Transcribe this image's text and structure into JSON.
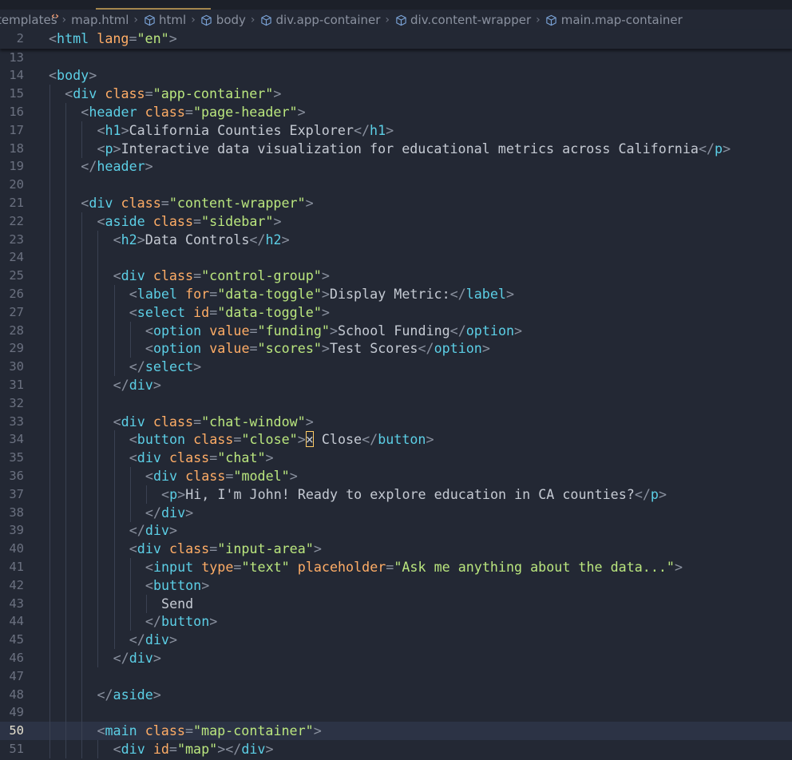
{
  "breadcrumb": [
    {
      "label": "templates",
      "icon": ""
    },
    {
      "label": "map.html",
      "icon": "html-file-icon"
    },
    {
      "label": "html",
      "icon": "element-cube-icon"
    },
    {
      "label": "body",
      "icon": "element-cube-icon"
    },
    {
      "label": "div.app-container",
      "icon": "element-cube-icon"
    },
    {
      "label": "div.content-wrapper",
      "icon": "element-cube-icon"
    },
    {
      "label": "main.map-container",
      "icon": "element-cube-icon"
    }
  ],
  "sticky": {
    "number": "2",
    "code": [
      {
        "t": "punct",
        "v": "<"
      },
      {
        "t": "tag",
        "v": "html"
      },
      {
        "t": "txt",
        "v": " "
      },
      {
        "t": "attr",
        "v": "lang"
      },
      {
        "t": "punct",
        "v": "="
      },
      {
        "t": "str",
        "v": "\"en\""
      },
      {
        "t": "punct",
        "v": ">"
      }
    ]
  },
  "current_line": "50",
  "colors": {
    "background": "#232834",
    "tag": "#5ccfe6",
    "attribute": "#ffad66",
    "string": "#bae67e",
    "text": "#c5cad3",
    "current_line": "#2c3345",
    "cursor": "#ffcc66"
  },
  "lines": [
    {
      "n": "13",
      "indent": 0,
      "code": []
    },
    {
      "n": "14",
      "indent": 0,
      "code": [
        {
          "t": "punct",
          "v": "<"
        },
        {
          "t": "tag",
          "v": "body"
        },
        {
          "t": "punct",
          "v": ">"
        }
      ]
    },
    {
      "n": "15",
      "indent": 1,
      "code": [
        {
          "t": "punct",
          "v": "<"
        },
        {
          "t": "tag",
          "v": "div"
        },
        {
          "t": "txt",
          "v": " "
        },
        {
          "t": "attr",
          "v": "class"
        },
        {
          "t": "punct",
          "v": "="
        },
        {
          "t": "str",
          "v": "\"app-container\""
        },
        {
          "t": "punct",
          "v": ">"
        }
      ]
    },
    {
      "n": "16",
      "indent": 2,
      "code": [
        {
          "t": "punct",
          "v": "<"
        },
        {
          "t": "tag",
          "v": "header"
        },
        {
          "t": "txt",
          "v": " "
        },
        {
          "t": "attr",
          "v": "class"
        },
        {
          "t": "punct",
          "v": "="
        },
        {
          "t": "str",
          "v": "\"page-header\""
        },
        {
          "t": "punct",
          "v": ">"
        }
      ]
    },
    {
      "n": "17",
      "indent": 3,
      "code": [
        {
          "t": "punct",
          "v": "<"
        },
        {
          "t": "tag",
          "v": "h1"
        },
        {
          "t": "punct",
          "v": ">"
        },
        {
          "t": "txt",
          "v": "California Counties Explorer"
        },
        {
          "t": "punct",
          "v": "</"
        },
        {
          "t": "tag",
          "v": "h1"
        },
        {
          "t": "punct",
          "v": ">"
        }
      ]
    },
    {
      "n": "18",
      "indent": 3,
      "code": [
        {
          "t": "punct",
          "v": "<"
        },
        {
          "t": "tag",
          "v": "p"
        },
        {
          "t": "punct",
          "v": ">"
        },
        {
          "t": "txt",
          "v": "Interactive data visualization for educational metrics across California"
        },
        {
          "t": "punct",
          "v": "</"
        },
        {
          "t": "tag",
          "v": "p"
        },
        {
          "t": "punct",
          "v": ">"
        }
      ]
    },
    {
      "n": "19",
      "indent": 2,
      "code": [
        {
          "t": "punct",
          "v": "</"
        },
        {
          "t": "tag",
          "v": "header"
        },
        {
          "t": "punct",
          "v": ">"
        }
      ]
    },
    {
      "n": "20",
      "indent": 0,
      "code": []
    },
    {
      "n": "21",
      "indent": 2,
      "code": [
        {
          "t": "punct",
          "v": "<"
        },
        {
          "t": "tag",
          "v": "div"
        },
        {
          "t": "txt",
          "v": " "
        },
        {
          "t": "attr",
          "v": "class"
        },
        {
          "t": "punct",
          "v": "="
        },
        {
          "t": "str",
          "v": "\"content-wrapper\""
        },
        {
          "t": "punct",
          "v": ">"
        }
      ]
    },
    {
      "n": "22",
      "indent": 3,
      "code": [
        {
          "t": "punct",
          "v": "<"
        },
        {
          "t": "tag",
          "v": "aside"
        },
        {
          "t": "txt",
          "v": " "
        },
        {
          "t": "attr",
          "v": "class"
        },
        {
          "t": "punct",
          "v": "="
        },
        {
          "t": "str",
          "v": "\"sidebar\""
        },
        {
          "t": "punct",
          "v": ">"
        }
      ]
    },
    {
      "n": "23",
      "indent": 4,
      "code": [
        {
          "t": "punct",
          "v": "<"
        },
        {
          "t": "tag",
          "v": "h2"
        },
        {
          "t": "punct",
          "v": ">"
        },
        {
          "t": "txt",
          "v": "Data Controls"
        },
        {
          "t": "punct",
          "v": "</"
        },
        {
          "t": "tag",
          "v": "h2"
        },
        {
          "t": "punct",
          "v": ">"
        }
      ]
    },
    {
      "n": "24",
      "indent": 0,
      "code": []
    },
    {
      "n": "25",
      "indent": 4,
      "code": [
        {
          "t": "punct",
          "v": "<"
        },
        {
          "t": "tag",
          "v": "div"
        },
        {
          "t": "txt",
          "v": " "
        },
        {
          "t": "attr",
          "v": "class"
        },
        {
          "t": "punct",
          "v": "="
        },
        {
          "t": "str",
          "v": "\"control-group\""
        },
        {
          "t": "punct",
          "v": ">"
        }
      ]
    },
    {
      "n": "26",
      "indent": 5,
      "code": [
        {
          "t": "punct",
          "v": "<"
        },
        {
          "t": "tag",
          "v": "label"
        },
        {
          "t": "txt",
          "v": " "
        },
        {
          "t": "attr",
          "v": "for"
        },
        {
          "t": "punct",
          "v": "="
        },
        {
          "t": "str",
          "v": "\"data-toggle\""
        },
        {
          "t": "punct",
          "v": ">"
        },
        {
          "t": "txt",
          "v": "Display Metric:"
        },
        {
          "t": "punct",
          "v": "</"
        },
        {
          "t": "tag",
          "v": "label"
        },
        {
          "t": "punct",
          "v": ">"
        }
      ]
    },
    {
      "n": "27",
      "indent": 5,
      "code": [
        {
          "t": "punct",
          "v": "<"
        },
        {
          "t": "tag",
          "v": "select"
        },
        {
          "t": "txt",
          "v": " "
        },
        {
          "t": "attr",
          "v": "id"
        },
        {
          "t": "punct",
          "v": "="
        },
        {
          "t": "str",
          "v": "\"data-toggle\""
        },
        {
          "t": "punct",
          "v": ">"
        }
      ]
    },
    {
      "n": "28",
      "indent": 6,
      "code": [
        {
          "t": "punct",
          "v": "<"
        },
        {
          "t": "tag",
          "v": "option"
        },
        {
          "t": "txt",
          "v": " "
        },
        {
          "t": "attr",
          "v": "value"
        },
        {
          "t": "punct",
          "v": "="
        },
        {
          "t": "str",
          "v": "\"funding\""
        },
        {
          "t": "punct",
          "v": ">"
        },
        {
          "t": "txt",
          "v": "School Funding"
        },
        {
          "t": "punct",
          "v": "</"
        },
        {
          "t": "tag",
          "v": "option"
        },
        {
          "t": "punct",
          "v": ">"
        }
      ]
    },
    {
      "n": "29",
      "indent": 6,
      "code": [
        {
          "t": "punct",
          "v": "<"
        },
        {
          "t": "tag",
          "v": "option"
        },
        {
          "t": "txt",
          "v": " "
        },
        {
          "t": "attr",
          "v": "value"
        },
        {
          "t": "punct",
          "v": "="
        },
        {
          "t": "str",
          "v": "\"scores\""
        },
        {
          "t": "punct",
          "v": ">"
        },
        {
          "t": "txt",
          "v": "Test Scores"
        },
        {
          "t": "punct",
          "v": "</"
        },
        {
          "t": "tag",
          "v": "option"
        },
        {
          "t": "punct",
          "v": ">"
        }
      ]
    },
    {
      "n": "30",
      "indent": 5,
      "code": [
        {
          "t": "punct",
          "v": "</"
        },
        {
          "t": "tag",
          "v": "select"
        },
        {
          "t": "punct",
          "v": ">"
        }
      ]
    },
    {
      "n": "31",
      "indent": 4,
      "code": [
        {
          "t": "punct",
          "v": "</"
        },
        {
          "t": "tag",
          "v": "div"
        },
        {
          "t": "punct",
          "v": ">"
        }
      ]
    },
    {
      "n": "32",
      "indent": 0,
      "code": []
    },
    {
      "n": "33",
      "indent": 4,
      "code": [
        {
          "t": "punct",
          "v": "<"
        },
        {
          "t": "tag",
          "v": "div"
        },
        {
          "t": "txt",
          "v": " "
        },
        {
          "t": "attr",
          "v": "class"
        },
        {
          "t": "punct",
          "v": "="
        },
        {
          "t": "str",
          "v": "\"chat-window\""
        },
        {
          "t": "punct",
          "v": ">"
        }
      ]
    },
    {
      "n": "34",
      "indent": 5,
      "code": [
        {
          "t": "punct",
          "v": "<"
        },
        {
          "t": "tag",
          "v": "button"
        },
        {
          "t": "txt",
          "v": " "
        },
        {
          "t": "attr",
          "v": "class"
        },
        {
          "t": "punct",
          "v": "="
        },
        {
          "t": "str",
          "v": "\"close\""
        },
        {
          "t": "punct",
          "v": ">"
        },
        {
          "t": "cur",
          "v": "×"
        },
        {
          "t": "txt",
          "v": " Close"
        },
        {
          "t": "punct",
          "v": "</"
        },
        {
          "t": "tag",
          "v": "button"
        },
        {
          "t": "punct",
          "v": ">"
        }
      ]
    },
    {
      "n": "35",
      "indent": 5,
      "code": [
        {
          "t": "punct",
          "v": "<"
        },
        {
          "t": "tag",
          "v": "div"
        },
        {
          "t": "txt",
          "v": " "
        },
        {
          "t": "attr",
          "v": "class"
        },
        {
          "t": "punct",
          "v": "="
        },
        {
          "t": "str",
          "v": "\"chat\""
        },
        {
          "t": "punct",
          "v": ">"
        }
      ]
    },
    {
      "n": "36",
      "indent": 6,
      "code": [
        {
          "t": "punct",
          "v": "<"
        },
        {
          "t": "tag",
          "v": "div"
        },
        {
          "t": "txt",
          "v": " "
        },
        {
          "t": "attr",
          "v": "class"
        },
        {
          "t": "punct",
          "v": "="
        },
        {
          "t": "str",
          "v": "\"model\""
        },
        {
          "t": "punct",
          "v": ">"
        }
      ]
    },
    {
      "n": "37",
      "indent": 7,
      "code": [
        {
          "t": "punct",
          "v": "<"
        },
        {
          "t": "tag",
          "v": "p"
        },
        {
          "t": "punct",
          "v": ">"
        },
        {
          "t": "txt",
          "v": "Hi, I'm John! Ready to explore education in CA counties?"
        },
        {
          "t": "punct",
          "v": "</"
        },
        {
          "t": "tag",
          "v": "p"
        },
        {
          "t": "punct",
          "v": ">"
        }
      ]
    },
    {
      "n": "38",
      "indent": 6,
      "code": [
        {
          "t": "punct",
          "v": "</"
        },
        {
          "t": "tag",
          "v": "div"
        },
        {
          "t": "punct",
          "v": ">"
        }
      ]
    },
    {
      "n": "39",
      "indent": 5,
      "code": [
        {
          "t": "punct",
          "v": "</"
        },
        {
          "t": "tag",
          "v": "div"
        },
        {
          "t": "punct",
          "v": ">"
        }
      ]
    },
    {
      "n": "40",
      "indent": 5,
      "code": [
        {
          "t": "punct",
          "v": "<"
        },
        {
          "t": "tag",
          "v": "div"
        },
        {
          "t": "txt",
          "v": " "
        },
        {
          "t": "attr",
          "v": "class"
        },
        {
          "t": "punct",
          "v": "="
        },
        {
          "t": "str",
          "v": "\"input-area\""
        },
        {
          "t": "punct",
          "v": ">"
        }
      ]
    },
    {
      "n": "41",
      "indent": 6,
      "code": [
        {
          "t": "punct",
          "v": "<"
        },
        {
          "t": "tag",
          "v": "input"
        },
        {
          "t": "txt",
          "v": " "
        },
        {
          "t": "attr",
          "v": "type"
        },
        {
          "t": "punct",
          "v": "="
        },
        {
          "t": "str",
          "v": "\"text\""
        },
        {
          "t": "txt",
          "v": " "
        },
        {
          "t": "attr",
          "v": "placeholder"
        },
        {
          "t": "punct",
          "v": "="
        },
        {
          "t": "str",
          "v": "\"Ask me anything about the data...\""
        },
        {
          "t": "punct",
          "v": ">"
        }
      ]
    },
    {
      "n": "42",
      "indent": 6,
      "code": [
        {
          "t": "punct",
          "v": "<"
        },
        {
          "t": "tag",
          "v": "button"
        },
        {
          "t": "punct",
          "v": ">"
        }
      ]
    },
    {
      "n": "43",
      "indent": 7,
      "code": [
        {
          "t": "txt",
          "v": "Send"
        }
      ]
    },
    {
      "n": "44",
      "indent": 6,
      "code": [
        {
          "t": "punct",
          "v": "</"
        },
        {
          "t": "tag",
          "v": "button"
        },
        {
          "t": "punct",
          "v": ">"
        }
      ]
    },
    {
      "n": "45",
      "indent": 5,
      "code": [
        {
          "t": "punct",
          "v": "</"
        },
        {
          "t": "tag",
          "v": "div"
        },
        {
          "t": "punct",
          "v": ">"
        }
      ]
    },
    {
      "n": "46",
      "indent": 4,
      "code": [
        {
          "t": "punct",
          "v": "</"
        },
        {
          "t": "tag",
          "v": "div"
        },
        {
          "t": "punct",
          "v": ">"
        }
      ]
    },
    {
      "n": "47",
      "indent": 0,
      "code": []
    },
    {
      "n": "48",
      "indent": 3,
      "code": [
        {
          "t": "punct",
          "v": "</"
        },
        {
          "t": "tag",
          "v": "aside"
        },
        {
          "t": "punct",
          "v": ">"
        }
      ]
    },
    {
      "n": "49",
      "indent": 0,
      "code": []
    },
    {
      "n": "50",
      "indent": 3,
      "code": [
        {
          "t": "punct",
          "v": "<"
        },
        {
          "t": "tag",
          "v": "main"
        },
        {
          "t": "txt",
          "v": " "
        },
        {
          "t": "attr",
          "v": "class"
        },
        {
          "t": "punct",
          "v": "="
        },
        {
          "t": "str",
          "v": "\"map-container\""
        },
        {
          "t": "punct",
          "v": ">"
        }
      ]
    },
    {
      "n": "51",
      "indent": 4,
      "code": [
        {
          "t": "punct",
          "v": "<"
        },
        {
          "t": "tag",
          "v": "div"
        },
        {
          "t": "txt",
          "v": " "
        },
        {
          "t": "attr",
          "v": "id"
        },
        {
          "t": "punct",
          "v": "="
        },
        {
          "t": "str",
          "v": "\"map\""
        },
        {
          "t": "punct",
          "v": "></"
        },
        {
          "t": "tag",
          "v": "div"
        },
        {
          "t": "punct",
          "v": ">"
        }
      ]
    }
  ]
}
